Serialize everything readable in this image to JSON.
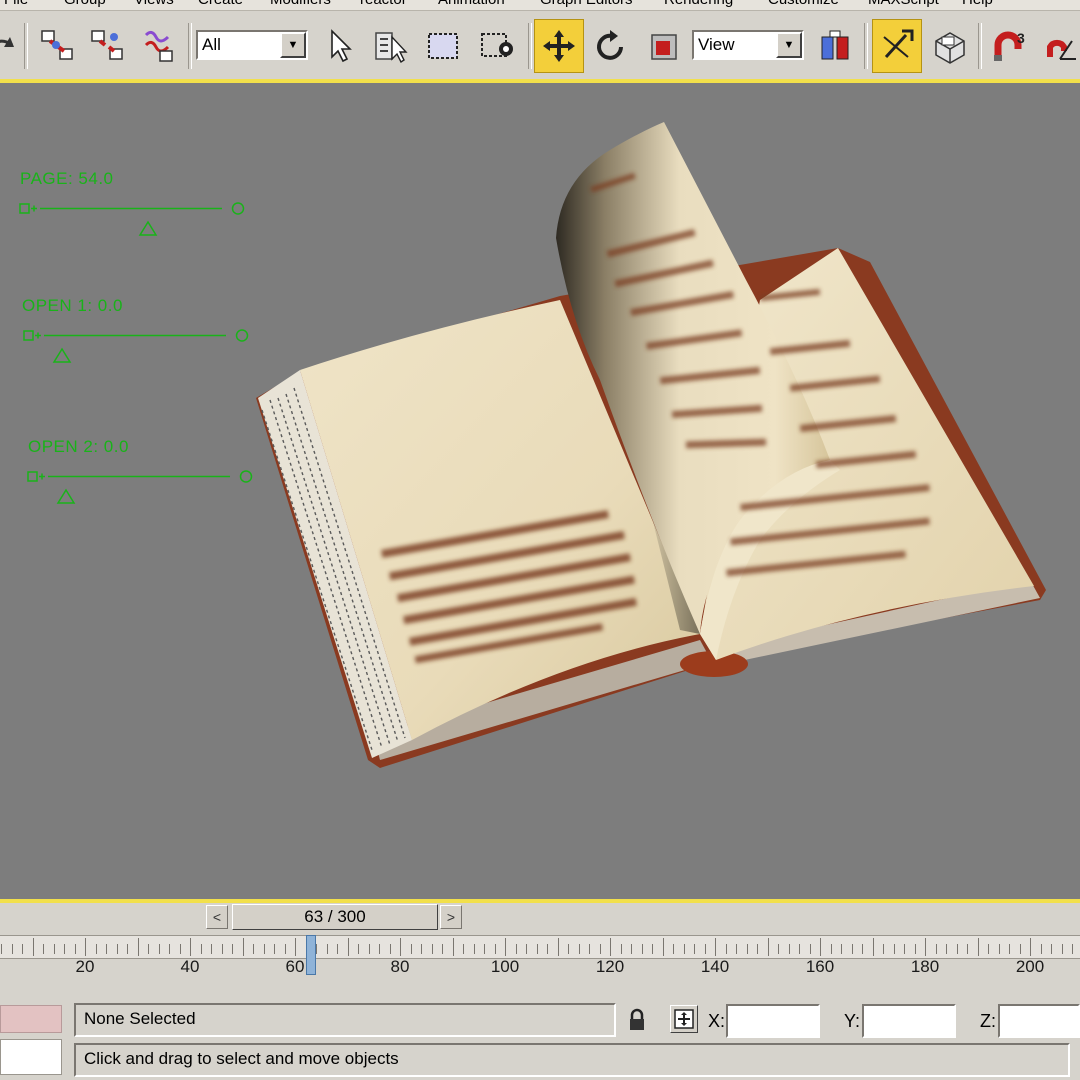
{
  "menubar": {
    "items": [
      "File",
      "Group",
      "Views",
      "Create",
      "Modifiers",
      "reactor",
      "Animation",
      "Graph Editors",
      "Rendering",
      "Customize",
      "MAXScript",
      "Help"
    ]
  },
  "toolbar": {
    "selection_filter": "All",
    "reference_coord": "View"
  },
  "viewport": {
    "background_color": "#7d7d7d",
    "hud_color": "#19b319",
    "sliders": [
      {
        "label": "PAGE: 54.0",
        "value_fraction": 0.54
      },
      {
        "label": "OPEN 1: 0.0",
        "value_fraction": 0.0
      },
      {
        "label": "OPEN 2: 0.0",
        "value_fraction": 0.0
      }
    ]
  },
  "time_slider": {
    "frame_label": "63 / 300",
    "current_frame": 63,
    "total_frames": 300,
    "prev_icon": "chevron-left-icon",
    "next_icon": "chevron-right-icon"
  },
  "trackbar": {
    "tick_labels": [
      "20",
      "40",
      "60",
      "80",
      "100",
      "120",
      "140",
      "160",
      "180",
      "200"
    ]
  },
  "status": {
    "selection": "None Selected",
    "prompt": "Click and drag to select and move objects",
    "x_label": "X:",
    "y_label": "Y:",
    "z_label": "Z:"
  }
}
